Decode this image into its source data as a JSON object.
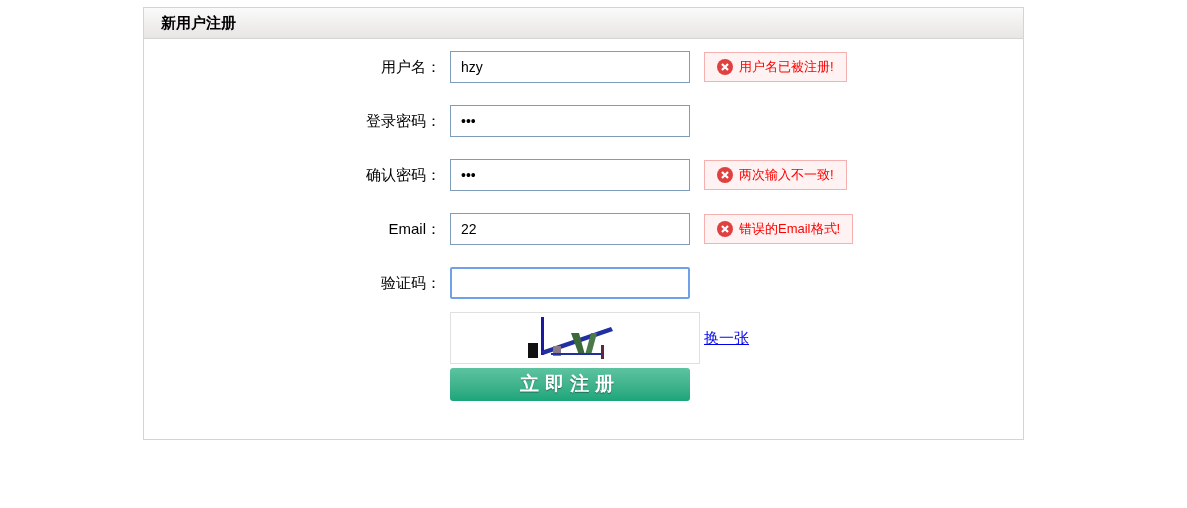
{
  "panel": {
    "title": "新用户注册"
  },
  "fields": [
    {
      "label": "用户名：",
      "value": "hzy",
      "focused": false,
      "error": "用户名已被注册!"
    },
    {
      "label": "登录密码：",
      "value": "•••",
      "focused": false
    },
    {
      "label": "确认密码：",
      "value": "•••",
      "focused": false,
      "error": "两次输入不一致!"
    },
    {
      "label": "Email：",
      "value": "22",
      "focused": false,
      "error": "错误的Email格式!"
    },
    {
      "label": "验证码：",
      "focused": true
    }
  ],
  "captcha": {
    "refresh_link": "换一张"
  },
  "submit_button": "立即注册"
}
